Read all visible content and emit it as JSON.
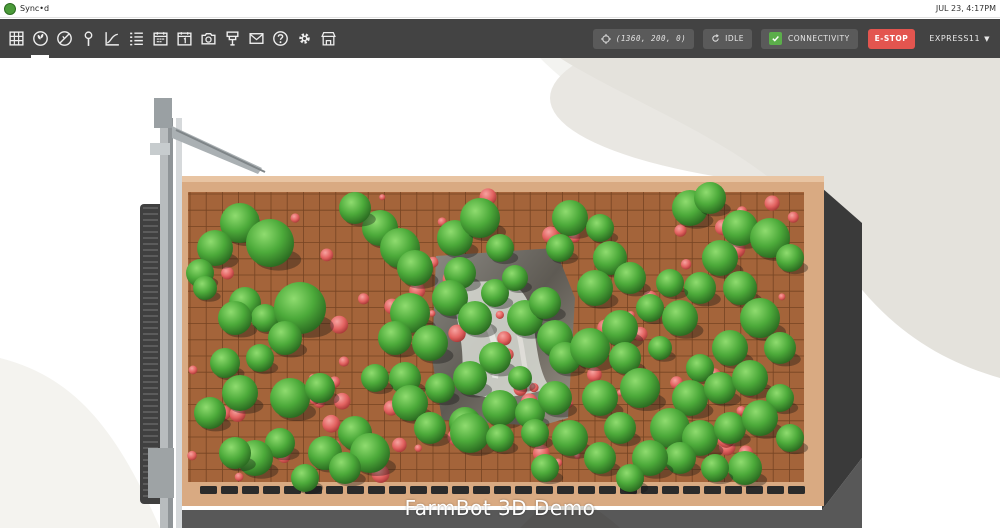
{
  "system_bar": {
    "app_title": "Sync•d",
    "clock": "JUL 23, 4:17PM"
  },
  "navbar": {
    "icons": [
      "map-grid-icon",
      "plants-icon",
      "weeds-icon",
      "points-icon",
      "curves-icon",
      "sequences-icon",
      "regimens-icon",
      "events-calendar-icon",
      "photos-icon",
      "tools-icon",
      "messages-icon",
      "help-icon",
      "settings-icon",
      "shop-icon"
    ],
    "active_index": 1,
    "position_readout": "(1360, 200, 0)",
    "status_label": "IDLE",
    "connectivity_label": "CONNECTIVITY",
    "estop_label": "E-STOP",
    "account_label": "EXPRESS11"
  },
  "colors": {
    "navbar_bg": "#434343",
    "pill_bg": "#5a5a5a",
    "estop_red": "#e3554f",
    "connectivity_green": "#5bae4a",
    "soil": "#a4643a",
    "bed_frame": "#d9aa82",
    "plant_green": "#4caa3a",
    "weed_red": "#e26260"
  },
  "scene": {
    "caption": "FarmBot 3D Demo"
  }
}
